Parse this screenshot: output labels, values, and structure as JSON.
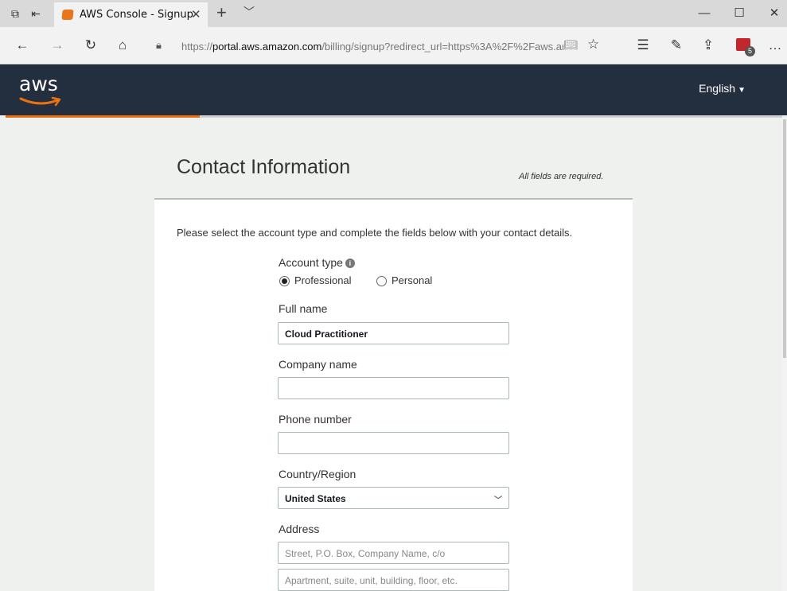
{
  "browser": {
    "tab_title": "AWS Console - Signup",
    "url_prefix": "https://",
    "url_host": "portal.aws.amazon.com",
    "url_rest": "/billing/signup?redirect_url=https%3A%2F%2Faws.am",
    "extension_badge": "5"
  },
  "icons": {
    "tab_preview": "tab-preview-icon",
    "set_aside": "set-aside-icon",
    "back": "back-arrow-icon",
    "forward": "forward-arrow-icon",
    "refresh": "refresh-icon",
    "home": "home-icon",
    "lock": "lock-icon",
    "reading_view": "reading-view-icon",
    "favorite": "star-icon",
    "favorites_list": "favorites-list-icon",
    "notes": "pen-icon",
    "share": "share-icon",
    "more": "more-icon",
    "info": "info-icon"
  },
  "colors": {
    "aws_header": "#232f3e",
    "aws_orange": "#ec7211",
    "page_bg": "#eff1ef"
  },
  "header": {
    "logo_text": "aws",
    "language": "English",
    "signup_progress": 0.25
  },
  "form": {
    "title": "Contact Information",
    "required_note": "All fields are required.",
    "intro": "Please select the account type and complete the fields below with your contact details.",
    "account_type_label": "Account type",
    "account_type_info": "i",
    "account_types": [
      {
        "label": "Professional",
        "selected": true
      },
      {
        "label": "Personal",
        "selected": false
      }
    ],
    "full_name_label": "Full name",
    "full_name_value": "Cloud Practitioner",
    "company_name_label": "Company name",
    "company_name_value": "",
    "phone_label": "Phone number",
    "phone_value": "",
    "country_label": "Country/Region",
    "country_value": "United States",
    "address_label": "Address",
    "address_line1_placeholder": "Street, P.O. Box, Company Name, c/o",
    "address_line2_placeholder": "Apartment, suite, unit, building, floor, etc."
  }
}
